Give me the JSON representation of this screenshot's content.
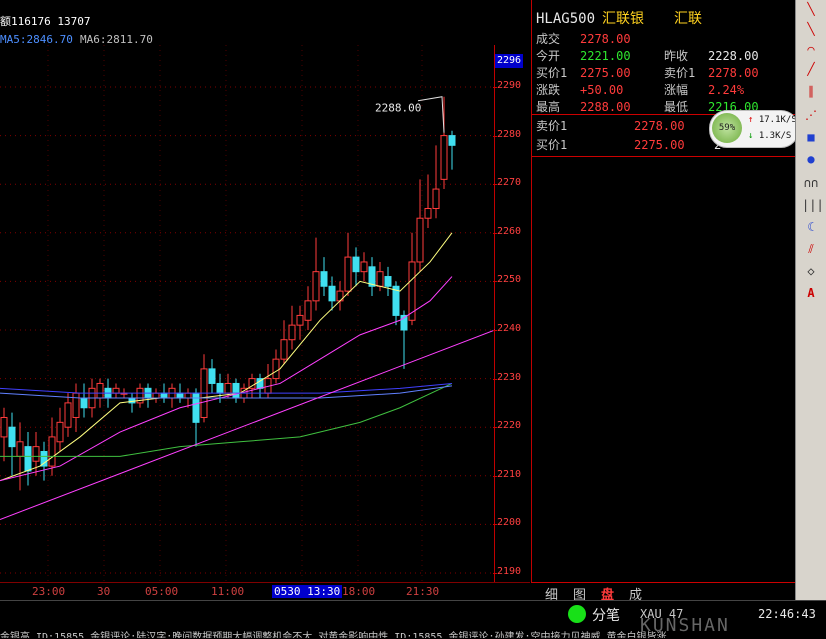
{
  "header": {
    "info": "额116176 13707",
    "ma5": "MA5:2846.70",
    "ma6": "MA6:2811.70"
  },
  "chart": {
    "high_label": "2288.00",
    "top_price_box": "2296",
    "y_ticks": [
      "2290",
      "2280",
      "2270",
      "2260",
      "2250",
      "2240",
      "2230",
      "2220",
      "2210",
      "2200",
      "2190"
    ],
    "x_ticks": [
      "23:00",
      "30",
      "05:00",
      "11:00",
      "0530 13:30",
      "18:00",
      "21:30"
    ],
    "colors": {
      "up": "#ff3b3b",
      "down": "#40e0f0",
      "ma_yellow": "#ffff80",
      "ma_magenta": "#ff40ff",
      "ma_green": "#40c040",
      "ma_blue": "#4040ff",
      "trend": "#ff40ff"
    }
  },
  "quote": {
    "symbol": "HLAG500",
    "name1": "汇联银",
    "name2": "汇联",
    "rows": [
      {
        "l1": "成交",
        "v1": "2278.00",
        "c1": "red"
      },
      {
        "l1": "今开",
        "v1": "2221.00",
        "c1": "green",
        "l2": "昨收",
        "v2": "2228.00",
        "c2": "white"
      },
      {
        "l1": "买价1",
        "v1": "2275.00",
        "c1": "red",
        "l2": "卖价1",
        "v2": "2278.00",
        "c2": "red"
      },
      {
        "l1": "涨跌",
        "v1": "+50.00",
        "c1": "red",
        "l2": "涨幅",
        "v2": "2.24%",
        "c2": "red"
      },
      {
        "l1": "最高",
        "v1": "2288.00",
        "c1": "red",
        "l2": "最低",
        "v2": "2216.00",
        "c2": "green"
      }
    ],
    "book": [
      {
        "l": "卖价1",
        "v": "2278.00",
        "extra": "7"
      },
      {
        "l": "买价1",
        "v": "2275.00",
        "extra": "2"
      }
    ]
  },
  "speed": {
    "pct": "59%",
    "up": "17.1K/S",
    "down": "1.3K/S"
  },
  "tabs": [
    "细",
    "图",
    "盘",
    "成"
  ],
  "status": {
    "label": "分笔",
    "code": "XAU 47",
    "time": "22:46:43",
    "watermark": "KUNSHAN"
  },
  "ticker": "金银高 ID:15855   金银评论:陆汉字:晚间数据预期大幅调整机会不大,对黄金影响中性 ID:15855   金银评论:孙建发:空中接力见神威 黄金白银皆涨"
}
